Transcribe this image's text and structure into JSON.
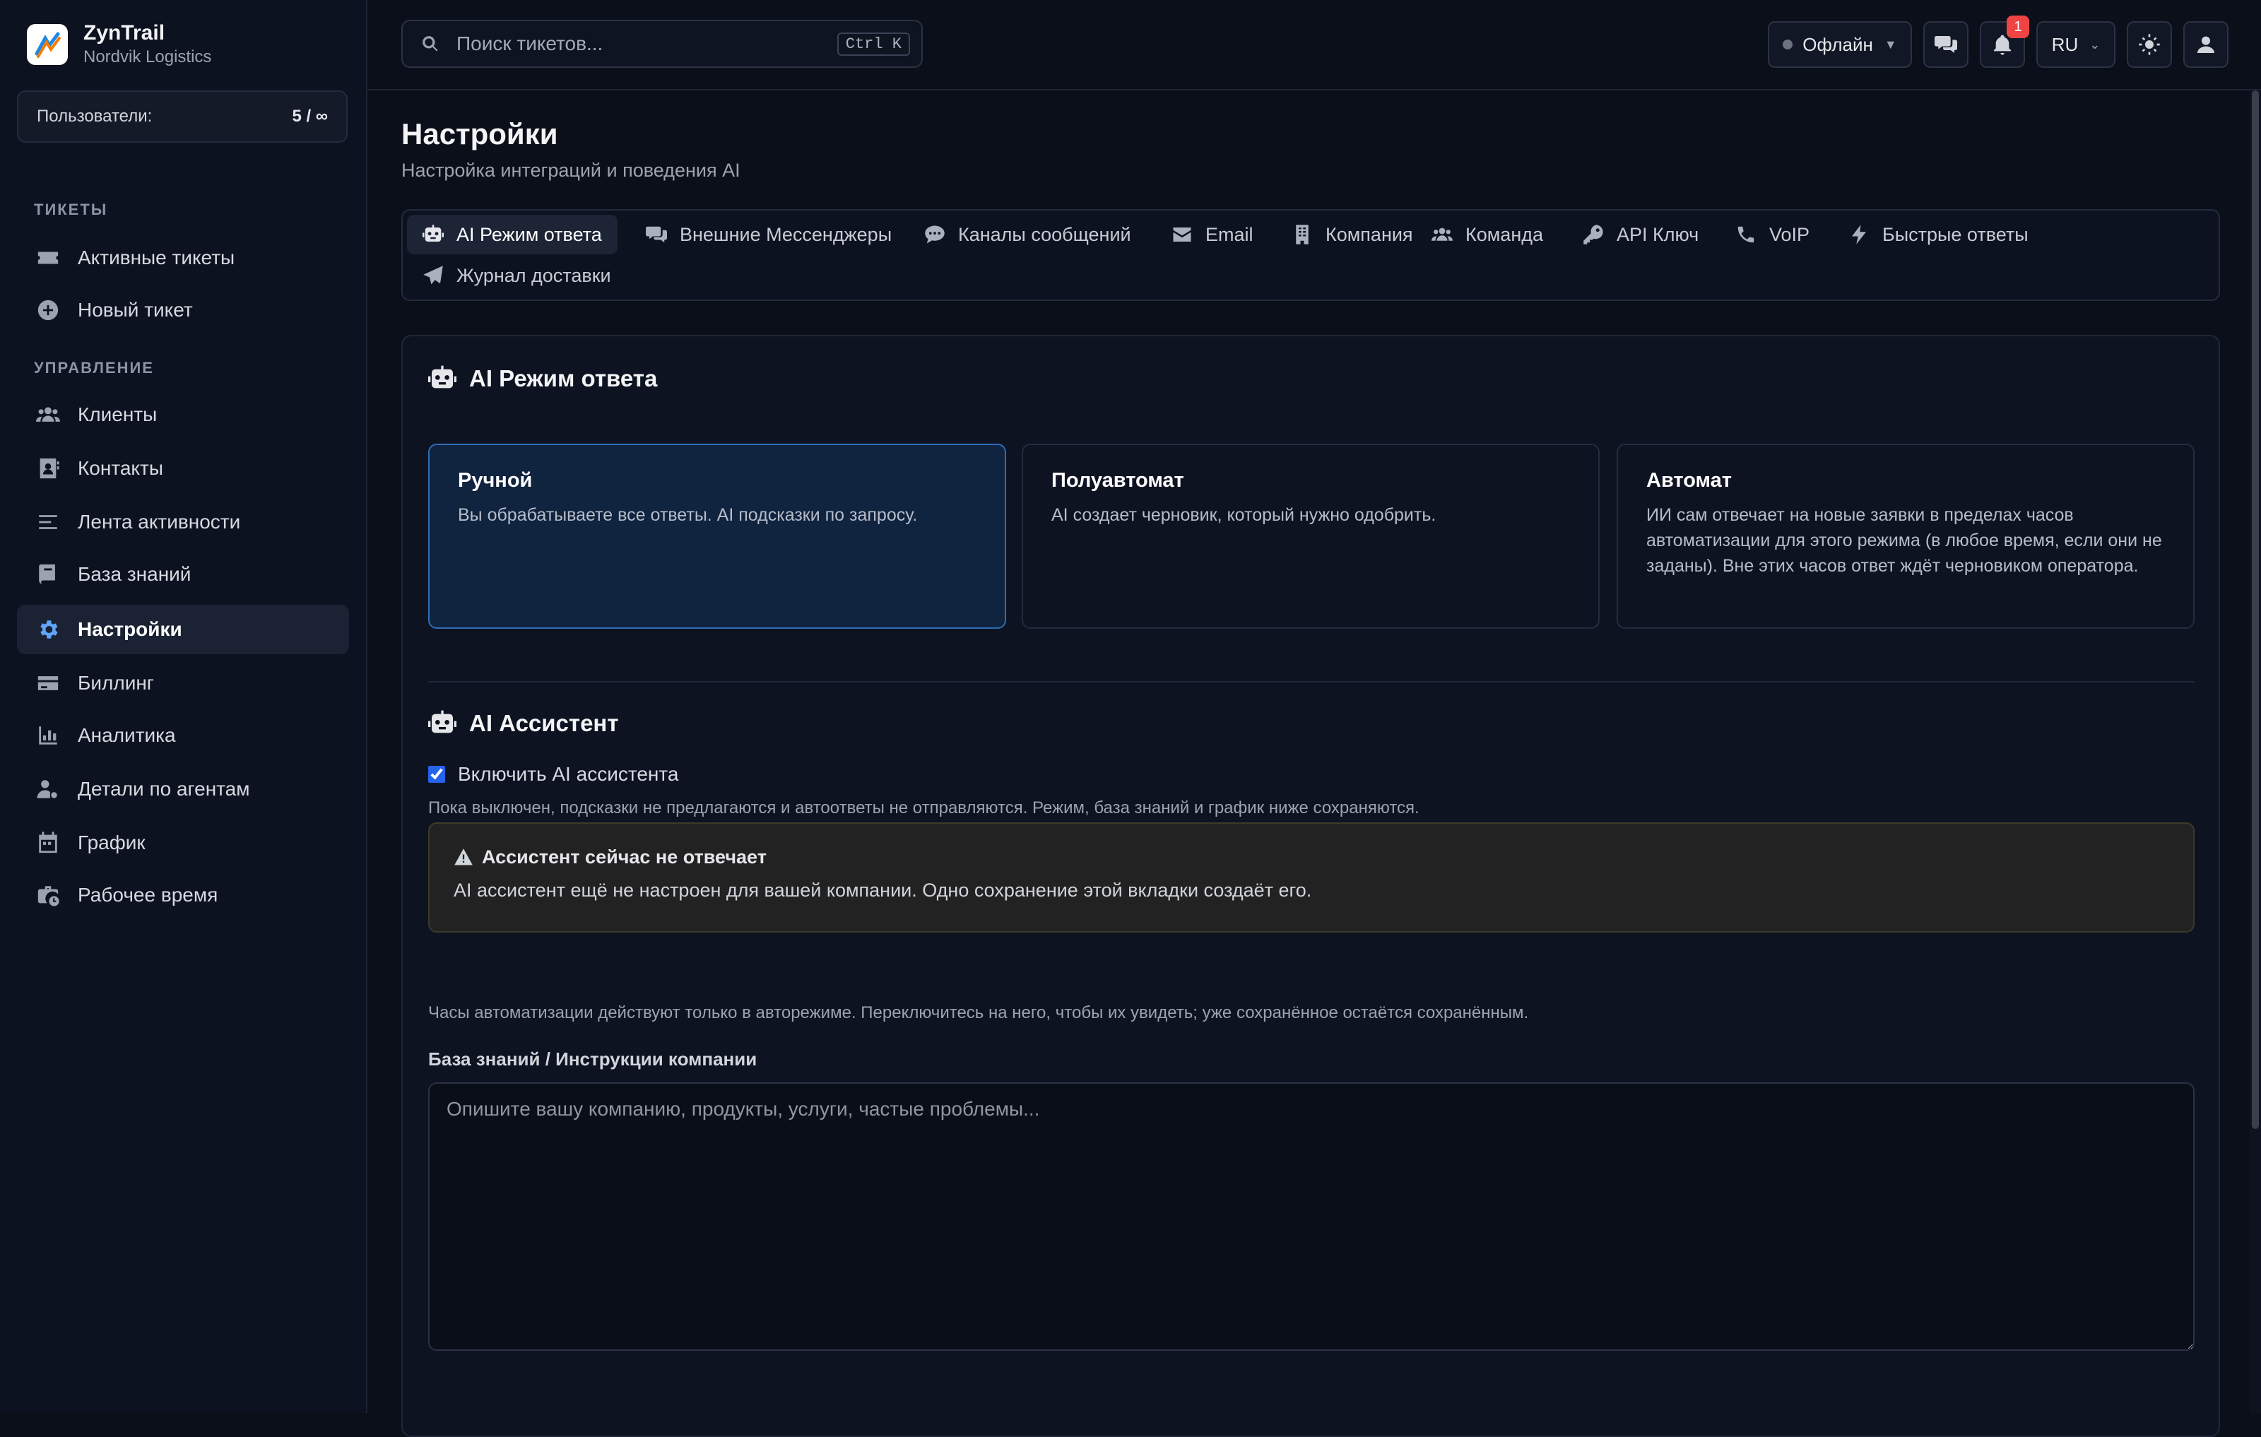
{
  "brand": {
    "name": "ZynTrail",
    "company": "Nordvik Logistics"
  },
  "users": {
    "label": "Пользователи:",
    "count": "5 / ∞"
  },
  "sidebar": {
    "section_tickets": "ТИКЕТЫ",
    "section_manage": "УПРАВЛЕНИЕ",
    "items": [
      {
        "label": "Активные тикеты",
        "icon": "ticket-icon"
      },
      {
        "label": "Новый тикет",
        "icon": "plus-circle-icon"
      },
      {
        "label": "Клиенты",
        "icon": "users-icon"
      },
      {
        "label": "Контакты",
        "icon": "address-book-icon"
      },
      {
        "label": "Лента активности",
        "icon": "list-icon"
      },
      {
        "label": "База знаний",
        "icon": "book-icon"
      },
      {
        "label": "Настройки",
        "icon": "gear-icon",
        "active": true
      },
      {
        "label": "Биллинг",
        "icon": "credit-card-icon"
      },
      {
        "label": "Аналитика",
        "icon": "bar-chart-icon"
      },
      {
        "label": "Детали по агентам",
        "icon": "user-gear-icon"
      },
      {
        "label": "График",
        "icon": "calendar-icon"
      },
      {
        "label": "Рабочее время",
        "icon": "briefcase-clock-icon"
      }
    ]
  },
  "topbar": {
    "search_placeholder": "Поиск тикетов...",
    "search_shortcut": "Ctrl K",
    "status": "Офлайн",
    "notifications_count": "1",
    "language": "RU"
  },
  "page": {
    "title": "Настройки",
    "subtitle": "Настройка интеграций и поведения AI"
  },
  "tabs": [
    {
      "label": "AI Режим ответа",
      "icon": "robot-icon",
      "active": true
    },
    {
      "label": "Внешние Мессенджеры",
      "icon": "comments-icon"
    },
    {
      "label": "Каналы сообщений",
      "icon": "comment-dots-icon"
    },
    {
      "label": "Email",
      "icon": "envelope-icon"
    },
    {
      "label": "Компания",
      "icon": "building-icon"
    },
    {
      "label": "Команда",
      "icon": "users-icon"
    },
    {
      "label": "API Ключ",
      "icon": "key-icon"
    },
    {
      "label": "VoIP",
      "icon": "phone-icon"
    },
    {
      "label": "Быстрые ответы",
      "icon": "bolt-icon"
    },
    {
      "label": "Журнал доставки",
      "icon": "paper-plane-icon"
    }
  ],
  "ai_mode": {
    "heading": "AI Режим ответа",
    "modes": [
      {
        "title": "Ручной",
        "desc": "Вы обрабатываете все ответы. AI подсказки по запросу.",
        "selected": true
      },
      {
        "title": "Полуавтомат",
        "desc": "AI создает черновик, который нужно одобрить."
      },
      {
        "title": "Автомат",
        "desc": "ИИ сам отвечает на новые заявки в пределах часов автоматизации для этого режима (в любое время, если они не заданы). Вне этих часов ответ ждёт черновиком оператора."
      }
    ]
  },
  "assistant": {
    "heading": "AI Ассистент",
    "enable_label": "Включить AI ассистента",
    "enabled": true,
    "off_hint": "Пока выключен, подсказки не предлагаются и автоответы не отправляются. Режим, база знаний и график ниже сохраняются.",
    "warning_title": "Ассистент сейчас не отвечает",
    "warning_text": "AI ассистент ещё не настроен для вашей компании. Одно сохранение этой вкладки создаёт его.",
    "hours_hint": "Часы автоматизации действуют только в авторежиме. Переключитесь на него, чтобы их увидеть; уже сохранённое остаётся сохранённым.",
    "kb_label": "База знаний / Инструкции компании",
    "kb_placeholder": "Опишите вашу компанию, продукты, услуги, частые проблемы..."
  }
}
